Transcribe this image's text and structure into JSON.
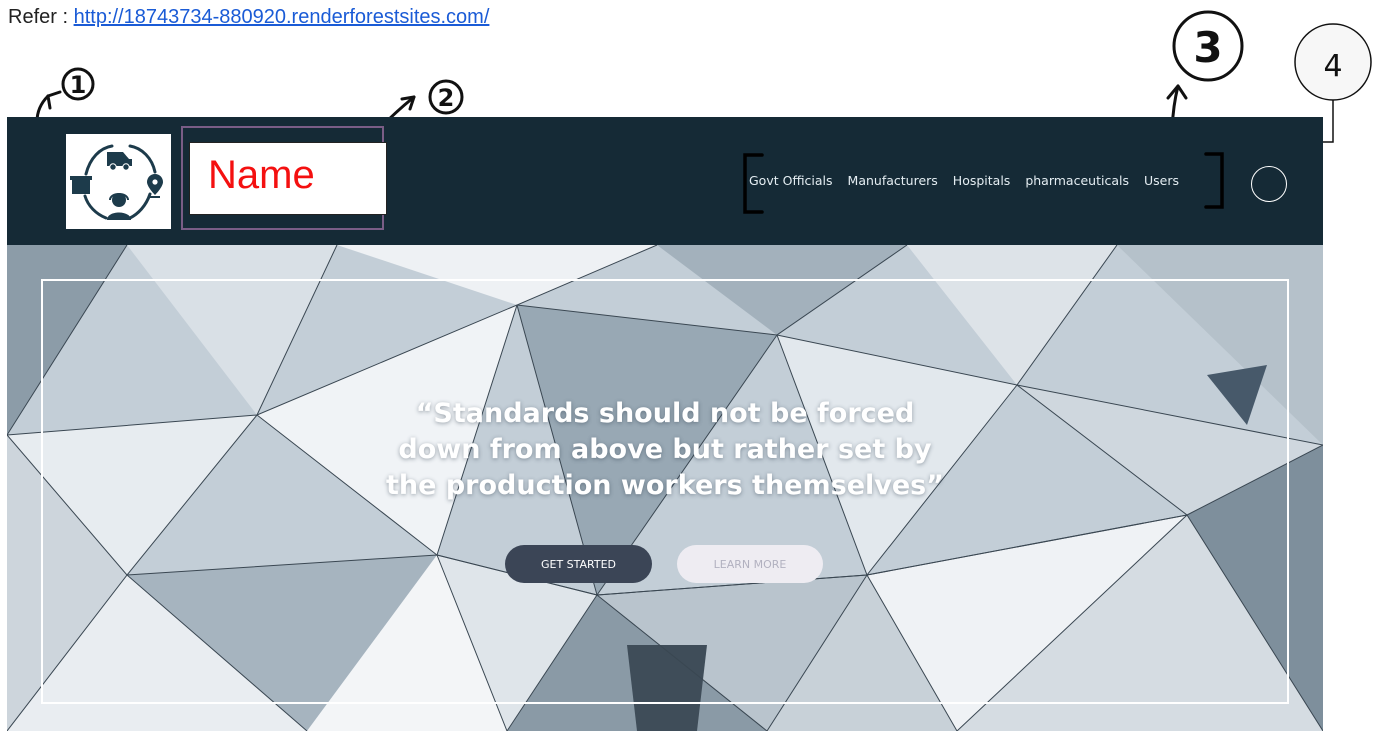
{
  "refer": {
    "label": "Refer : ",
    "url": "http://18743734-880920.renderforestsites.com/"
  },
  "annotations": {
    "marker_1": "1",
    "marker_2": "2",
    "marker_3": "3",
    "marker_4": "4"
  },
  "header": {
    "name_placeholder": "Name",
    "nav_items": [
      "Govt Officials",
      "Manufacturers",
      "Hospitals",
      "pharmaceuticals",
      "Users"
    ]
  },
  "hero": {
    "quote_line_1": "“Standards should not be forced",
    "quote_line_2": "down from above but rather set by",
    "quote_line_3": "the production workers themselves”",
    "get_started_label": "GET STARTED",
    "learn_more_label": "LEARN MORE"
  },
  "colors": {
    "navbar": "#152a36",
    "name_text": "#f41010",
    "primary_button": "#3b4556",
    "secondary_button": "#eeecf2",
    "link": "#1a5bd6"
  },
  "icons": [
    "delivery-van-icon",
    "package-box-icon",
    "location-pin-icon",
    "customer-support-icon",
    "cycle-arrows-icon"
  ]
}
